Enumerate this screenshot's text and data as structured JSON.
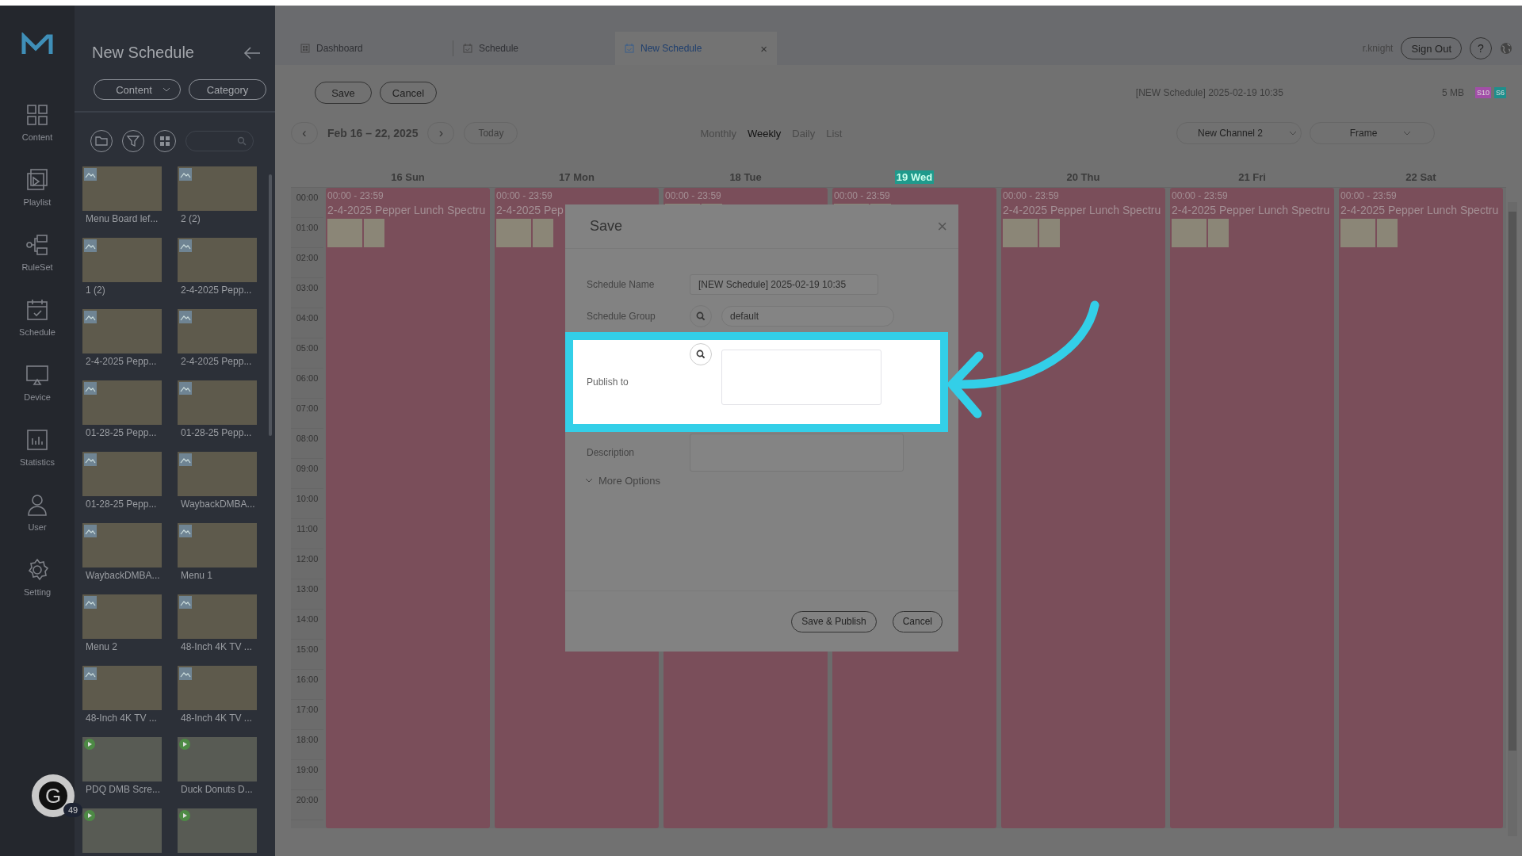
{
  "rail": [
    {
      "label": "Content",
      "kind": "content"
    },
    {
      "label": "Playlist",
      "kind": "playlist"
    },
    {
      "label": "RuleSet",
      "kind": "ruleset"
    },
    {
      "label": "Schedule",
      "kind": "schedule"
    },
    {
      "label": "Device",
      "kind": "device"
    },
    {
      "label": "Statistics",
      "kind": "statistics"
    },
    {
      "label": "User",
      "kind": "user"
    },
    {
      "label": "Setting",
      "kind": "setting"
    }
  ],
  "media_panel": {
    "title": "New Schedule",
    "filters": [
      "Content",
      "Category"
    ],
    "items": [
      {
        "label": "Menu Board lef...",
        "kind": "image"
      },
      {
        "label": "2 (2)",
        "kind": "image"
      },
      {
        "label": "1 (2)",
        "kind": "image"
      },
      {
        "label": "2-4-2025 Pepp...",
        "kind": "image"
      },
      {
        "label": "2-4-2025 Pepp...",
        "kind": "image"
      },
      {
        "label": "2-4-2025 Pepp...",
        "kind": "image"
      },
      {
        "label": "01-28-25 Pepp...",
        "kind": "image"
      },
      {
        "label": "01-28-25 Pepp...",
        "kind": "image"
      },
      {
        "label": "01-28-25 Pepp...",
        "kind": "image"
      },
      {
        "label": "WaybackDMBA...",
        "kind": "image"
      },
      {
        "label": "WaybackDMBA...",
        "kind": "image"
      },
      {
        "label": "Menu 1",
        "kind": "image"
      },
      {
        "label": "Menu 2",
        "kind": "image"
      },
      {
        "label": "48-Inch 4K TV ...",
        "kind": "image"
      },
      {
        "label": "48-Inch 4K TV ...",
        "kind": "image"
      },
      {
        "label": "48-Inch 4K TV ...",
        "kind": "image"
      },
      {
        "label": "PDQ DMB Scre...",
        "kind": "video"
      },
      {
        "label": "Duck Donuts D...",
        "kind": "video"
      },
      {
        "kind": "video"
      },
      {
        "kind": "video"
      }
    ]
  },
  "tabs": [
    {
      "label": "Dashboard",
      "kind": "dashboard",
      "selected": false
    },
    {
      "label": "Schedule",
      "kind": "calendar",
      "selected": false
    },
    {
      "label": "New Schedule",
      "kind": "calendar",
      "selected": true,
      "close": "×"
    }
  ],
  "user": {
    "name": "r.knight",
    "sign_out": "Sign Out",
    "help": "?"
  },
  "toolbar": {
    "buttons": [
      "Save",
      "Cancel"
    ],
    "schedule_title": "[NEW Schedule] 2025-02-19 10:35",
    "size": "5 MB",
    "badges": [
      {
        "label": "S10",
        "color": "#a24ea8"
      },
      {
        "label": "S6",
        "color": "#1e8f8c"
      }
    ]
  },
  "nav": {
    "prev": "‹",
    "range": "Feb 16 – 22, 2025",
    "next": "›",
    "today": {
      "label": "Today",
      "disabled": true
    },
    "views": [
      {
        "label": "Monthly",
        "selected": false
      },
      {
        "label": "Weekly",
        "selected": true
      },
      {
        "label": "Daily",
        "selected": false
      },
      {
        "label": "List",
        "selected": false
      }
    ],
    "channel": "New Channel 2",
    "frame": "Frame"
  },
  "calendar": {
    "hours": [
      "00:00",
      "01:00",
      "02:00",
      "03:00",
      "04:00",
      "05:00",
      "06:00",
      "07:00",
      "08:00",
      "09:00",
      "10:00",
      "11:00",
      "12:00",
      "13:00",
      "14:00",
      "15:00",
      "16:00",
      "17:00",
      "18:00",
      "19:00",
      "20:00"
    ],
    "days": [
      {
        "label": "16 Sun",
        "today": false,
        "event": {
          "time": "00:00 - 23:59",
          "title": "2-4-2025 Pepper Lunch Spectru"
        }
      },
      {
        "label": "17 Mon",
        "today": false,
        "event": {
          "time": "00:00 - 23:59",
          "title": "2-4-2025 Pep"
        }
      },
      {
        "label": "18 Tue",
        "today": false,
        "event": {
          "time": "00:00 - 23:59"
        }
      },
      {
        "label": "19 Wed",
        "today": true,
        "event": {
          "time": "00:00 - 23:59"
        }
      },
      {
        "label": "20 Thu",
        "today": false,
        "event": {
          "time": "00:00 - 23:59",
          "title": "2-4-2025 Pepper Lunch Spectru"
        }
      },
      {
        "label": "21 Fri",
        "today": false,
        "event": {
          "time": "00:00 - 23:59",
          "title": "2-4-2025 Pepper Lunch Spectru"
        }
      },
      {
        "label": "22 Sat",
        "today": false,
        "event": {
          "time": "00:00 - 23:59",
          "title": "2-4-2025 Pepper Lunch Spectru"
        }
      }
    ]
  },
  "dialog": {
    "title": "Save",
    "close": "×",
    "fields": [
      {
        "label": "Schedule Name",
        "kind": "text",
        "value": "[NEW Schedule] 2025-02-19 10:35",
        "highlighted": false
      },
      {
        "label": "Schedule Group",
        "kind": "search",
        "value": "default",
        "highlighted": false
      },
      {
        "label": "Publish to",
        "kind": "search-area",
        "highlighted": true
      },
      {
        "label": "Description",
        "kind": "area",
        "highlighted": false
      }
    ],
    "more_options": "More Options",
    "buttons": [
      "Save & Publish",
      "Cancel"
    ]
  },
  "assistant": {
    "glyph": "G",
    "count": "49"
  }
}
